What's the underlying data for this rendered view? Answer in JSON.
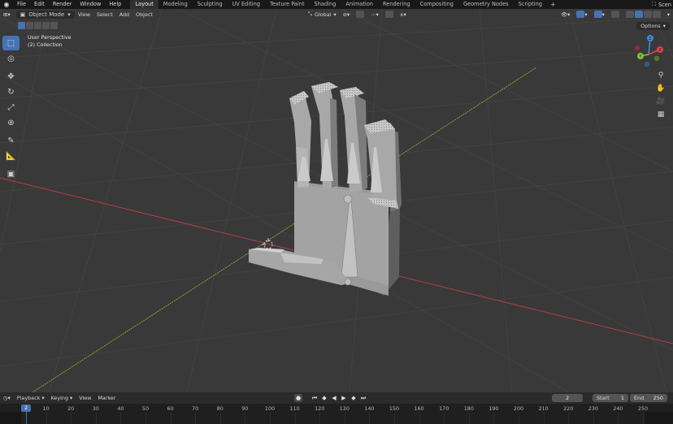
{
  "app": {
    "logo_icon": "blender-logo-icon"
  },
  "top_menu": [
    "File",
    "Edit",
    "Render",
    "Window",
    "Help"
  ],
  "workspaces": [
    {
      "label": "Layout",
      "active": true
    },
    {
      "label": "Modeling",
      "active": false
    },
    {
      "label": "Sculpting",
      "active": false
    },
    {
      "label": "UV Editing",
      "active": false
    },
    {
      "label": "Texture Paint",
      "active": false
    },
    {
      "label": "Shading",
      "active": false
    },
    {
      "label": "Animation",
      "active": false
    },
    {
      "label": "Rendering",
      "active": false
    },
    {
      "label": "Compositing",
      "active": false
    },
    {
      "label": "Geometry Nodes",
      "active": false
    },
    {
      "label": "Scripting",
      "active": false
    }
  ],
  "scene_label": "Scen",
  "viewport_header": {
    "mode": "Object Mode",
    "menus": [
      "View",
      "Select",
      "Add",
      "Object"
    ],
    "transform_orientation": "Global"
  },
  "viewport_info": {
    "perspective": "User Perspective",
    "collection": "(2) Collection"
  },
  "options_label": "Options",
  "gizmo": {
    "x_label": "X",
    "y_label": "Y",
    "z_label": "Z"
  },
  "timeline": {
    "menus": [
      "Playback",
      "Keying",
      "View",
      "Marker"
    ],
    "current_frame": "2",
    "start_label": "Start",
    "start_value": "1",
    "end_label": "End",
    "end_value": "250",
    "ticks": [
      "10",
      "20",
      "30",
      "40",
      "50",
      "60",
      "70",
      "80",
      "90",
      "100",
      "110",
      "120",
      "130",
      "140",
      "150",
      "160",
      "170",
      "180",
      "190",
      "200",
      "210",
      "220",
      "230",
      "240",
      "250"
    ],
    "cursor_label": "2"
  },
  "colors": {
    "accent": "#4772b3",
    "x_axis": "#e0414f",
    "y_axis": "#86c232",
    "z_axis": "#3d8fe0",
    "viewport_bg": "#393939"
  }
}
